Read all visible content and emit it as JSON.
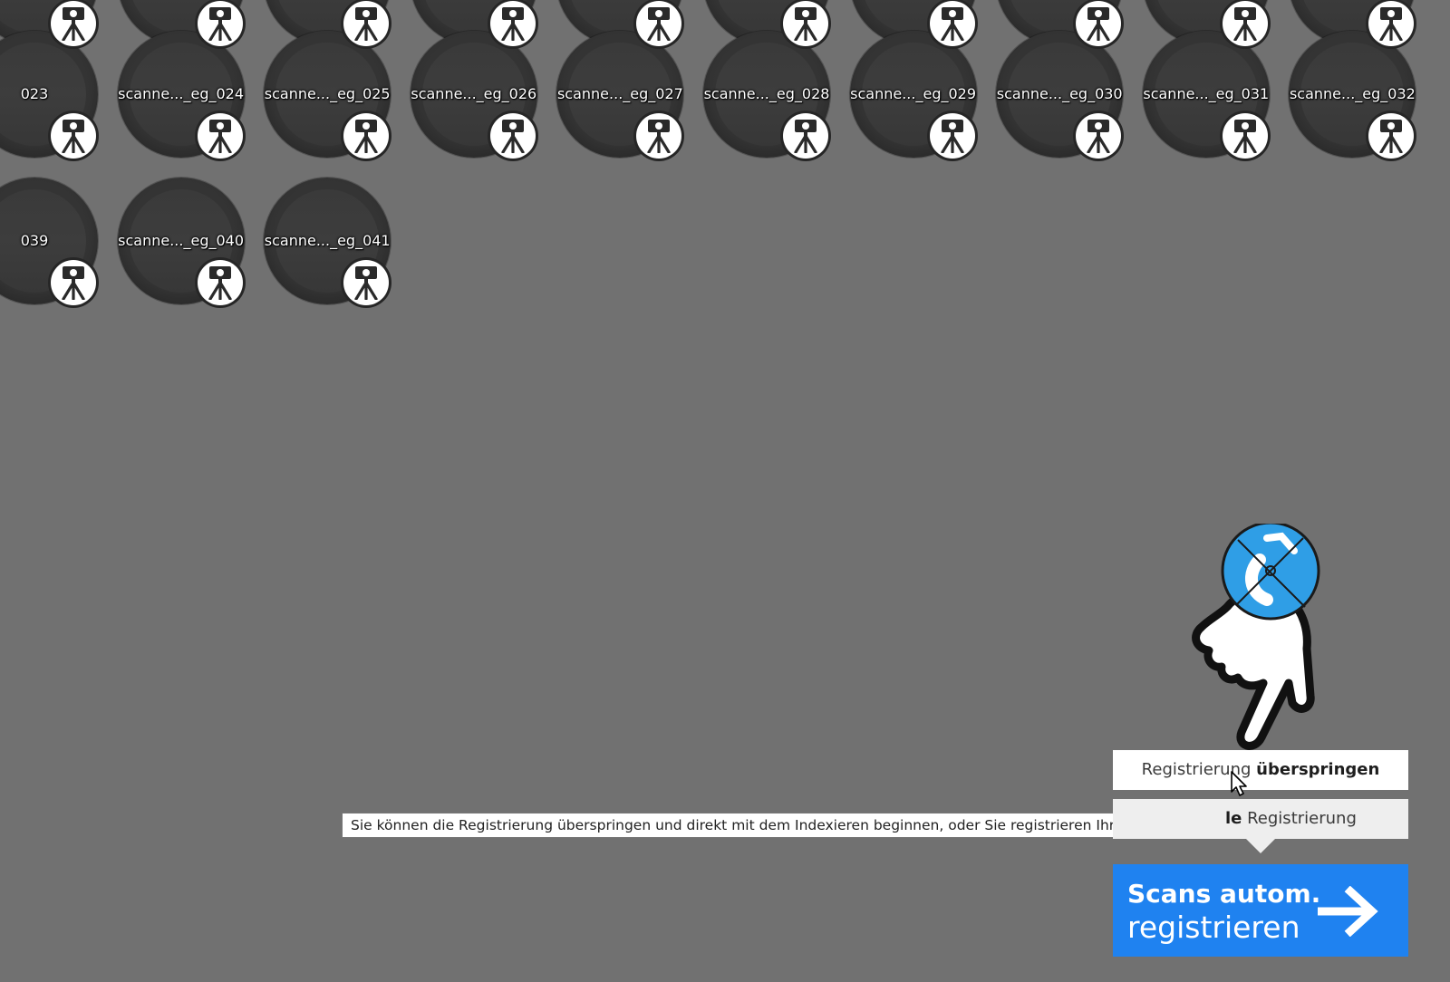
{
  "scans": {
    "row1": [
      "",
      "",
      "",
      "",
      "",
      "",
      "",
      "",
      "",
      ""
    ],
    "row2": [
      "023",
      "scanne..._eg_024",
      "scanne..._eg_025",
      "scanne..._eg_026",
      "scanne..._eg_027",
      "scanne..._eg_028",
      "scanne..._eg_029",
      "scanne..._eg_030",
      "scanne..._eg_031",
      "scanne..._eg_032"
    ],
    "row3": [
      "039",
      "scanne..._eg_040",
      "scanne..._eg_041"
    ]
  },
  "scan_icon": "tripod-scanner-icon",
  "options": {
    "skip": {
      "prefix": "Registrierung ",
      "bold": "überspringen"
    },
    "manual": {
      "bold": "le",
      "rest": " Registrierung"
    }
  },
  "tooltip": "Sie können die Registrierung überspringen und direkt mit dem Indexieren beginnen, oder Sie registrieren Ihre Scans erneut",
  "auto_register_button": {
    "line1": "Scans autom.",
    "line2": "registrieren",
    "icon": "arrow-right-icon"
  },
  "overlay": {
    "hand_icon": "tutorial-pointing-hand-icon",
    "badge_icon": "logo-target-icon",
    "cursor_icon": "mouse-pointer-icon"
  },
  "colors": {
    "background": "#717171",
    "accent": "#1f82f0",
    "badge_blue": "#2f9ee6"
  }
}
